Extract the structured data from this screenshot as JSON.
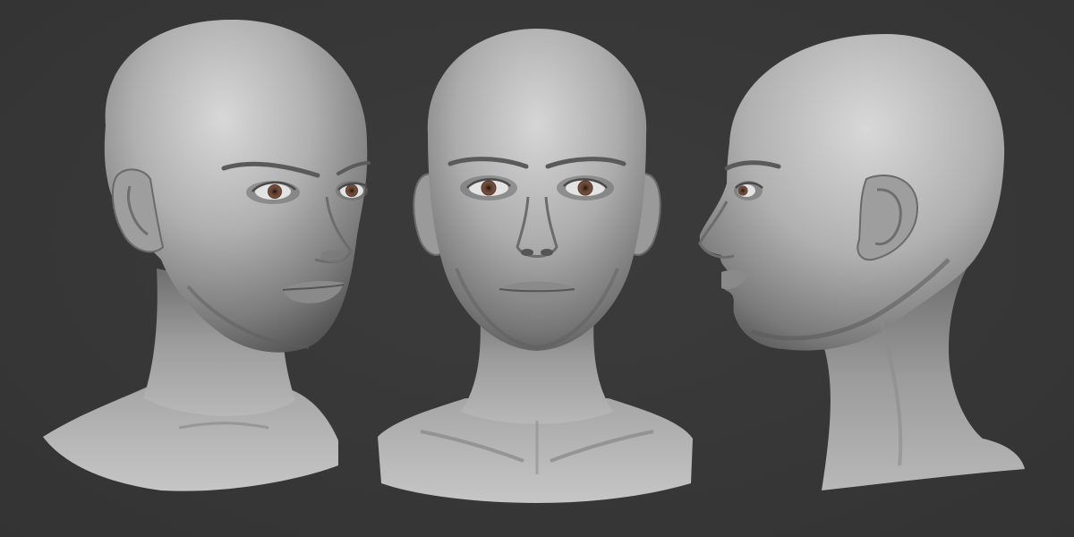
{
  "scene": {
    "background_color": "#383838",
    "clay_color": "#a8a8a8",
    "clay_highlight": "#d6d6d6",
    "clay_shadow": "#4a4a4a",
    "iris_color": "#5a3a2a",
    "views": [
      {
        "name": "three-quarter-view"
      },
      {
        "name": "front-view"
      },
      {
        "name": "side-profile-view"
      }
    ]
  }
}
